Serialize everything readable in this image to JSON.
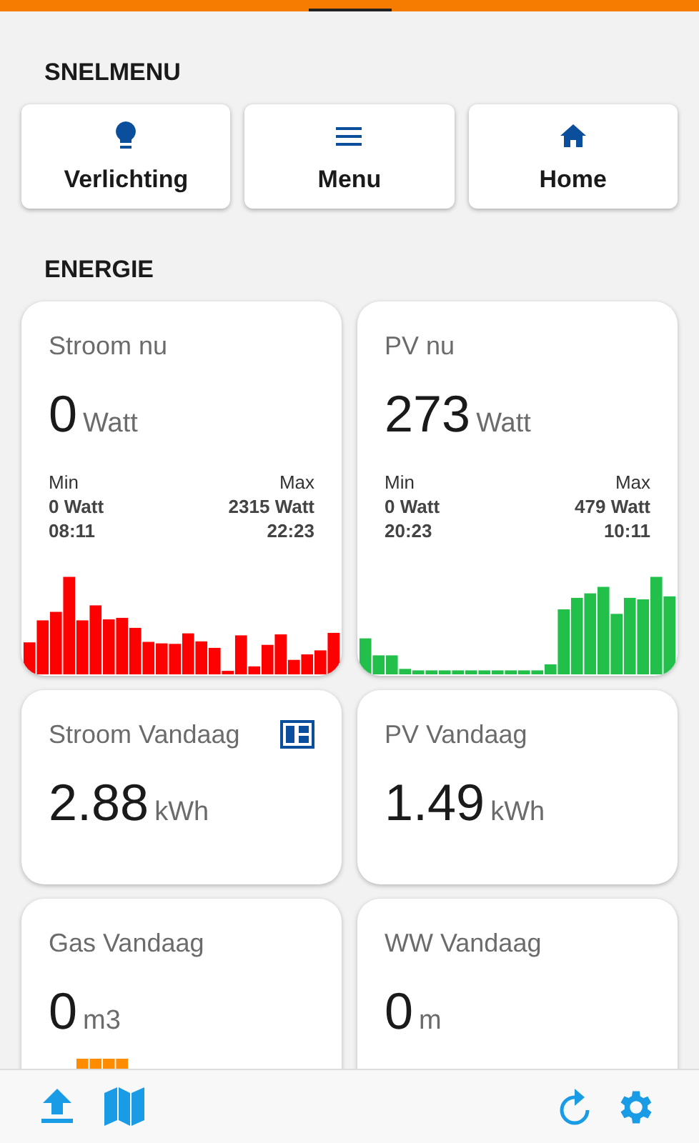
{
  "sections": [
    {
      "title": "SNELMENU"
    },
    {
      "title": "ENERGIE"
    }
  ],
  "quick_buttons": [
    {
      "label": "Verlichting",
      "kind": "bulb"
    },
    {
      "label": "Menu",
      "kind": "menu"
    },
    {
      "label": "Home",
      "kind": "home"
    }
  ],
  "cards": [
    {
      "title": "Stroom nu",
      "value": "0",
      "unit": "Watt",
      "kind": "minmax",
      "min_label": "Min",
      "min_value": "0 Watt",
      "min_time": "08:11",
      "max_label": "Max",
      "max_value": "2315 Watt",
      "max_time": "22:23",
      "color": "#ff0000"
    },
    {
      "title": "PV nu",
      "value": "273",
      "unit": "Watt",
      "kind": "minmax",
      "min_label": "Min",
      "min_value": "0 Watt",
      "min_time": "20:23",
      "max_label": "Max",
      "max_value": "479 Watt",
      "max_time": "10:11",
      "color": "#22c04a"
    },
    {
      "title": "Stroom Vandaag",
      "value": "2.88",
      "unit": "kWh",
      "kind": "simple",
      "badge_icon": true
    },
    {
      "title": "PV Vandaag",
      "value": "1.49",
      "unit": "kWh",
      "kind": "simple"
    },
    {
      "title": "Gas Vandaag",
      "value": "0",
      "unit": "m3",
      "kind": "simple",
      "color": "#ff8c00"
    },
    {
      "title": "WW Vandaag",
      "value": "0",
      "unit": "m",
      "kind": "simple"
    }
  ]
}
